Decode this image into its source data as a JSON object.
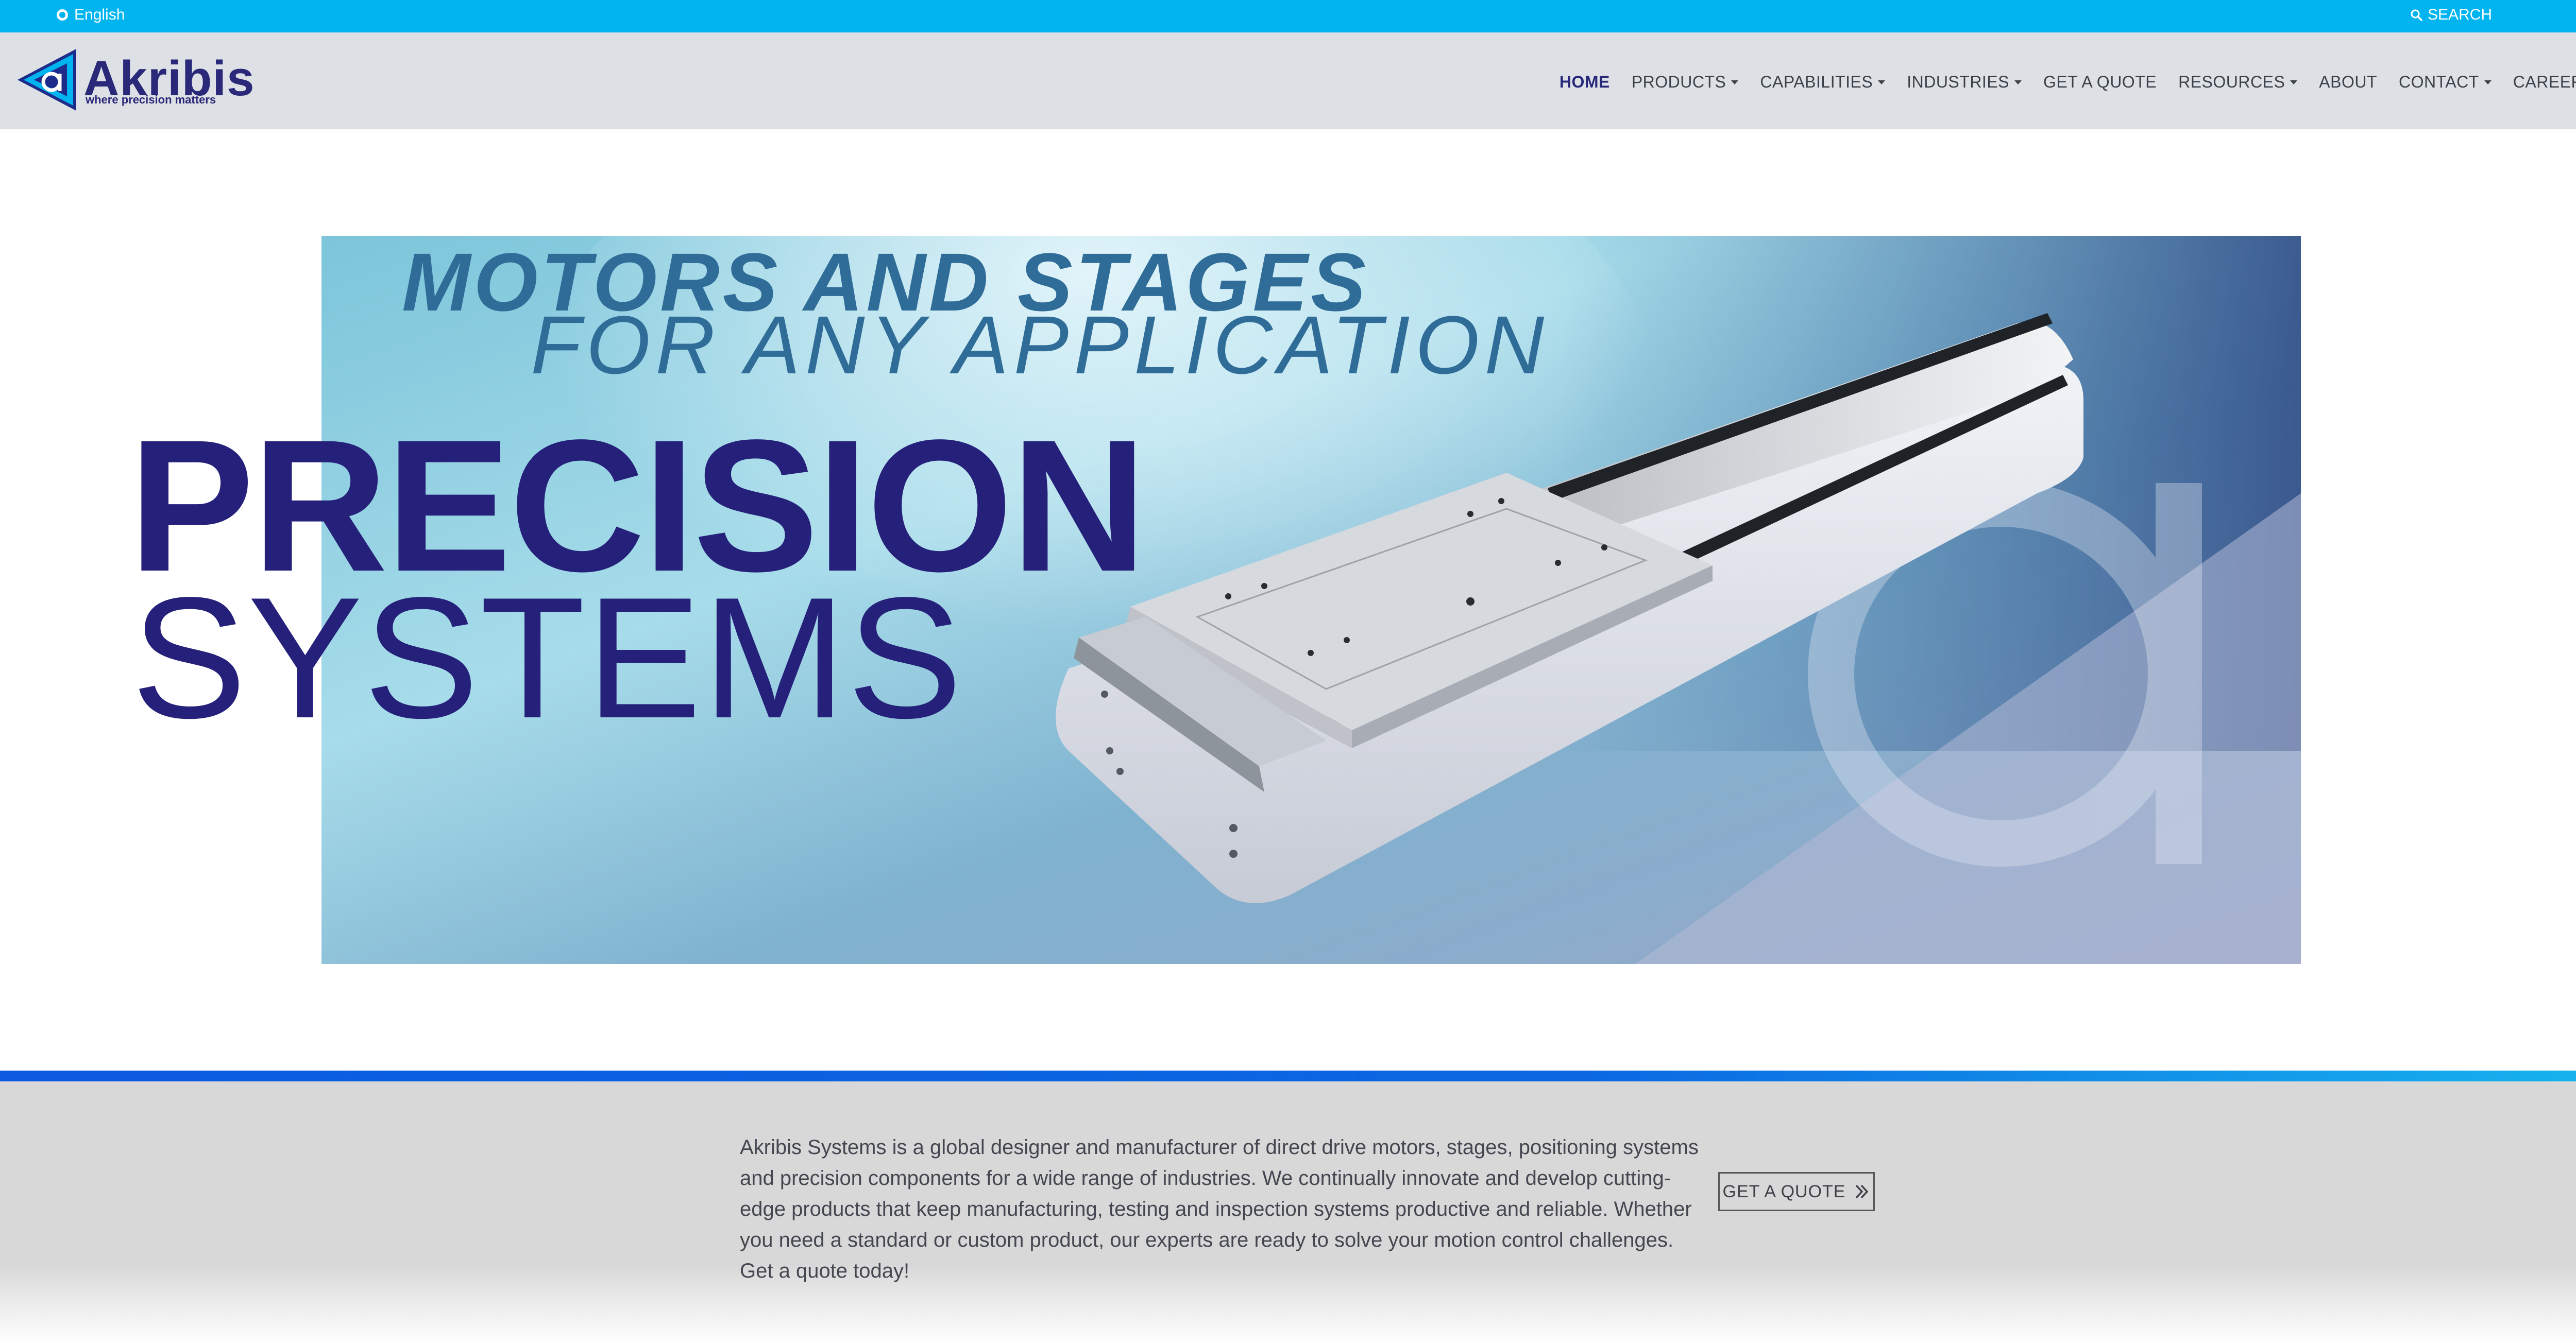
{
  "topbar": {
    "language": "English",
    "search_label": "SEARCH"
  },
  "logo": {
    "name": "Akribis",
    "tagline": "where precision matters"
  },
  "nav": {
    "home": "HOME",
    "products": "PRODUCTS",
    "capabilities": "CAPABILITIES",
    "industries": "INDUSTRIES",
    "get_a_quote": "GET A QUOTE",
    "resources": "RESOURCES",
    "about": "ABOUT",
    "contact": "CONTACT",
    "careers": "CAREERS"
  },
  "hero": {
    "tagline_line1": "MOTORS AND STAGES",
    "tagline_line2": "FOR ANY APPLICATION",
    "title": "PRECISION",
    "subtitle": "SYSTEMS"
  },
  "intro": {
    "text": "Akribis Systems is a global designer and manufacturer of direct drive motors, stages, positioning systems and precision components for a wide range of industries. We continually innovate and develop cutting-edge products that keep manufacturing, testing and inspection systems productive and reliable. Whether you need a standard or custom product, our experts are ready to solve your motion control challenges. Get a quote today!",
    "cta_label": "GET A QUOTE"
  },
  "colors": {
    "topbar": "#00b4ef",
    "header": "#dde0e5",
    "brand_navy": "#25207a",
    "tagline_blue": "#2f6c98",
    "band": "#d8d8d8",
    "accent_line": "#0d5be0"
  },
  "icons": {
    "language": "globe-ring-icon",
    "search": "search-icon",
    "dropdown": "caret-down-icon",
    "cta": "double-chevron-right-icon"
  }
}
